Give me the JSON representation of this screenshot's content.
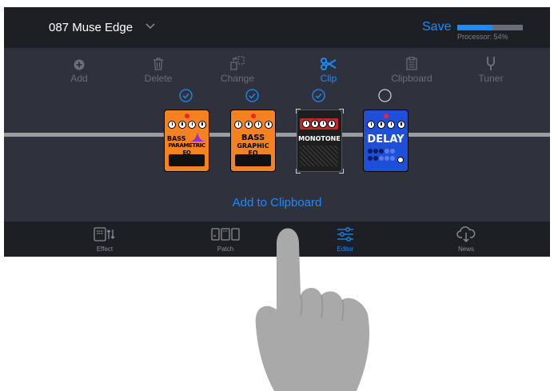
{
  "header": {
    "patch_name": "087 Muse Edge",
    "save_label": "Save",
    "processor_label": "Processor: 54%",
    "processor_percent": 54
  },
  "toolbar": {
    "items": [
      {
        "label": "Add",
        "icon": "plus-circle-icon"
      },
      {
        "label": "Delete",
        "icon": "trash-icon"
      },
      {
        "label": "Change",
        "icon": "swap-icon"
      },
      {
        "label": "Clip",
        "icon": "scissors-icon"
      },
      {
        "label": "Clipboard",
        "icon": "clipboard-icon"
      },
      {
        "label": "Tuner",
        "icon": "tuning-fork-icon"
      }
    ],
    "active": "Clip"
  },
  "pedals": [
    {
      "line1": "BASS",
      "line2": "PARAMETRIC EQ",
      "selected": true,
      "color": "#f58220"
    },
    {
      "line1": "BASS",
      "line2": "GRAPHIC EQ",
      "selected": true,
      "color": "#f58220"
    },
    {
      "line1": "MONOTONE",
      "line2": "",
      "selected": true,
      "color": "#222222"
    },
    {
      "line1": "DELAY",
      "line2": "",
      "selected": false,
      "color": "#1e4fd8"
    }
  ],
  "add_to_clipboard_label": "Add to Clipboard",
  "tabs": [
    {
      "label": "Effect",
      "icon": "effect-icon"
    },
    {
      "label": "Patch",
      "icon": "patch-icon"
    },
    {
      "label": "Editor",
      "icon": "sliders-icon"
    },
    {
      "label": "News",
      "icon": "cloud-download-icon"
    }
  ],
  "active_tab": "Editor",
  "colors": {
    "accent": "#1a8cff",
    "app_bg": "#2f323c",
    "bar_bg": "#1d1f25"
  }
}
